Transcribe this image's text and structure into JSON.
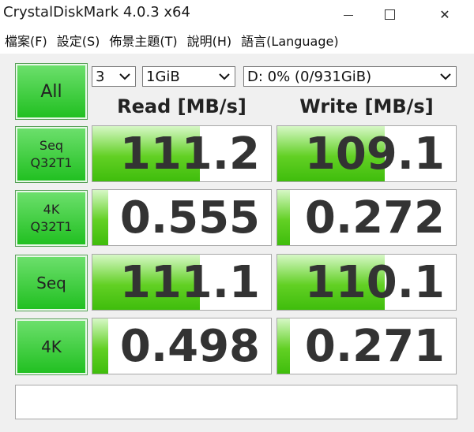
{
  "window": {
    "title": "CrystalDiskMark 4.0.3 x64",
    "minimize_glyph": "",
    "close_glyph": "✕"
  },
  "menu": [
    {
      "label": "檔案(F)"
    },
    {
      "label": "設定(S)"
    },
    {
      "label": "佈景主題(T)"
    },
    {
      "label": "說明(H)"
    },
    {
      "label": "語言(Language)"
    }
  ],
  "controls": {
    "all_label": "All",
    "count": "3",
    "size": "1GiB",
    "drive": "D: 0% (0/931GiB)"
  },
  "headers": {
    "read": "Read [MB/s]",
    "write": "Write [MB/s]"
  },
  "rows": [
    {
      "label_line1": "Seq",
      "label_line2": "Q32T1",
      "read": "111.2",
      "write": "109.1",
      "read_fill": 0.6,
      "write_fill": 0.6
    },
    {
      "label_line1": "4K",
      "label_line2": "Q32T1",
      "read": "0.555",
      "write": "0.272",
      "read_fill": 0.09,
      "write_fill": 0.07
    },
    {
      "label_line1": "Seq",
      "label_line2": "",
      "read": "111.1",
      "write": "110.1",
      "read_fill": 0.6,
      "write_fill": 0.6
    },
    {
      "label_line1": "4K",
      "label_line2": "",
      "read": "0.498",
      "write": "0.271",
      "read_fill": 0.09,
      "write_fill": 0.07
    }
  ],
  "status_text": "",
  "colors": {
    "button_green": "#1fbf1f",
    "bar_green": "#62d024"
  }
}
